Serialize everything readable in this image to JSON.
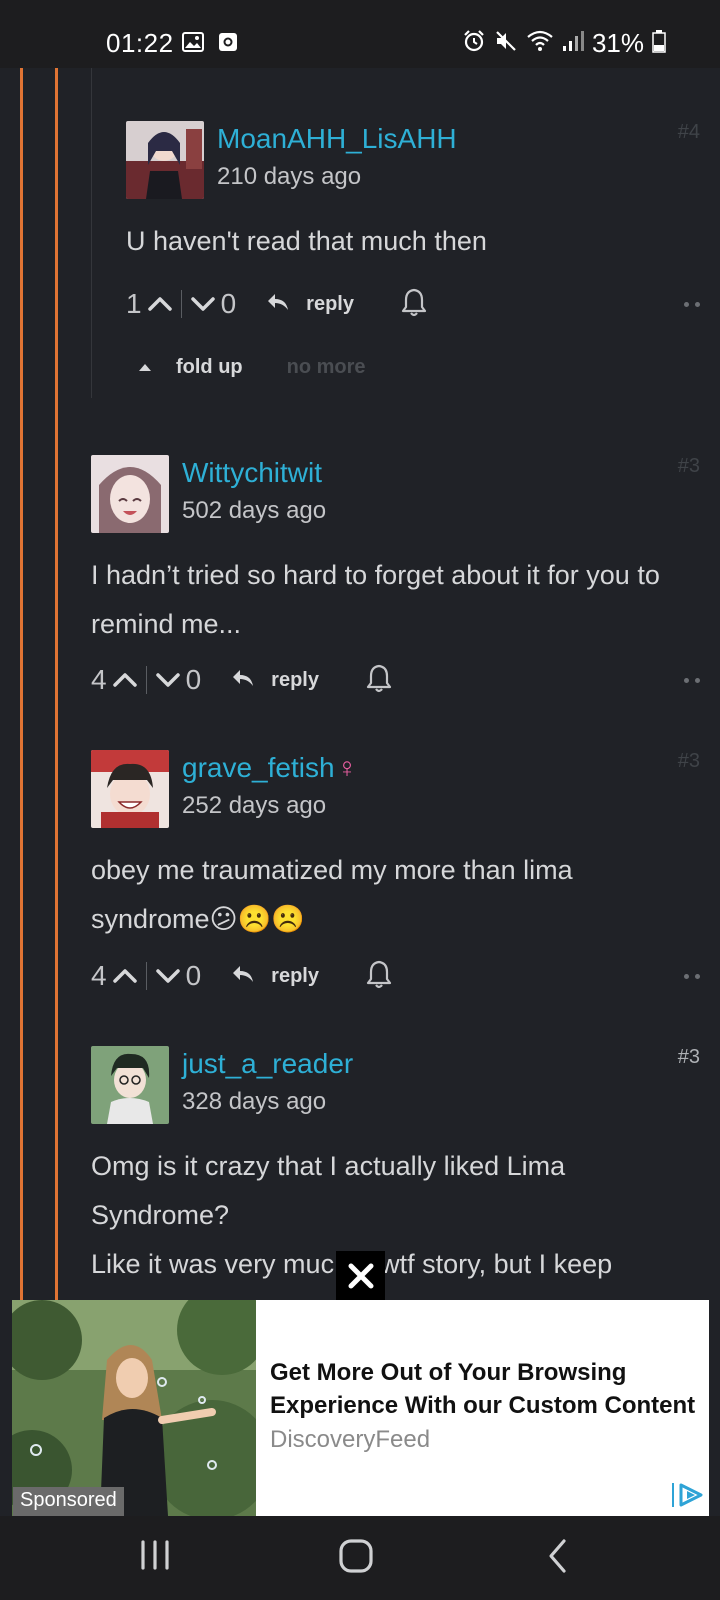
{
  "status_bar": {
    "time": "01:22",
    "battery": "31%",
    "left_icons": [
      "gallery-icon",
      "screen-record-icon"
    ],
    "right_icons": [
      "alarm-icon",
      "mute-icon",
      "wifi-icon",
      "signal-icon",
      "battery-icon"
    ]
  },
  "comments": [
    {
      "username": "MoanAHH_LisAHH",
      "time_ago": "210 days ago",
      "rank": "#4",
      "body": "U haven't read that much then",
      "upvotes": "1",
      "downvotes": "0",
      "reply_label": "reply"
    },
    {
      "username": "Wittychitwit",
      "time_ago": "502 days ago",
      "rank": "#3",
      "body": "I hadn’t tried so hard to forget about it for you to remind me...",
      "upvotes": "4",
      "downvotes": "0",
      "reply_label": "reply"
    },
    {
      "username": "grave_fetish",
      "gender_symbol": "♀",
      "time_ago": "252 days ago",
      "rank": "#3",
      "body": "obey me traumatized my more than lima syndrome😕☹️☹️",
      "upvotes": "4",
      "downvotes": "0",
      "reply_label": "reply"
    },
    {
      "username": "just_a_reader",
      "time_ago": "328 days ago",
      "rank": "#3",
      "body_line1": "Omg is it crazy that I actually liked Lima Syndrome?",
      "body_line2": "Like it was very muc",
      "body_line2_end": "wtf story, but I keep"
    }
  ],
  "fold": {
    "fold_label": "fold up",
    "no_more_label": "no more"
  },
  "ad": {
    "title": "Get More Out of Your Browsing Experience With our Custom Content",
    "source": "DiscoveryFeed",
    "sponsored_label": "Sponsored"
  },
  "colors": {
    "background": "#202227",
    "thread_line": "#e07434",
    "username": "#2eb0d6",
    "gender_female": "#ea5fa2"
  }
}
